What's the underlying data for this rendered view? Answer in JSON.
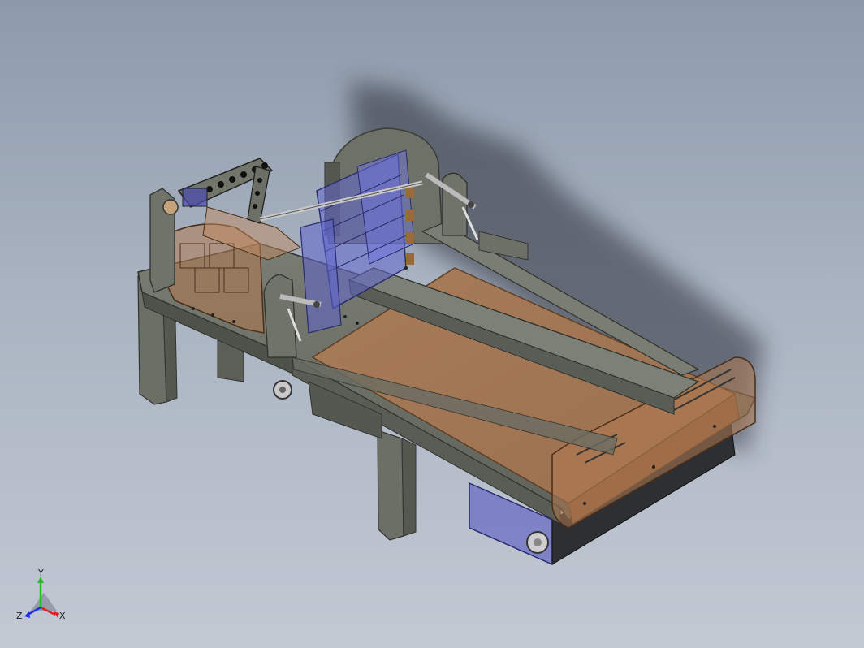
{
  "viewport": {
    "background_top": "#8e9aab",
    "background_bottom": "#c2c9d3"
  },
  "model": {
    "frame_color": "#6f7268",
    "frame_dark": "#4f524a",
    "belt_color": "#a57a58",
    "transparent_blue": "#5a5fc0",
    "transparent_brown": "#b0744a",
    "shadow_color": "#2a2e38"
  },
  "triad": {
    "x_label": "X",
    "y_label": "Y",
    "z_label": "Z",
    "x_color": "#e02020",
    "y_color": "#20c020",
    "z_color": "#2030e0"
  }
}
